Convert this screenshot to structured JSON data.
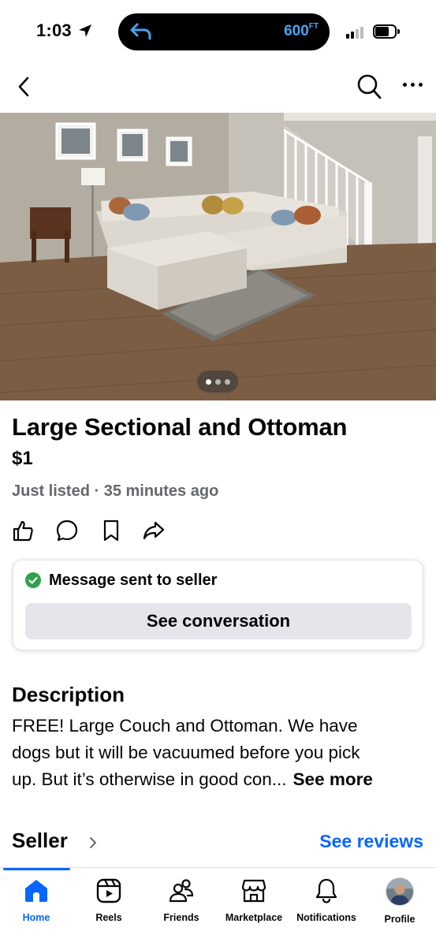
{
  "status_bar": {
    "time": "1:03",
    "altitude_value": "600",
    "altitude_unit": "FT"
  },
  "listing": {
    "title": "Large Sectional and Ottoman",
    "price": "$1",
    "meta": "Just listed · 35 minutes ago",
    "photo_pager": {
      "total": 3,
      "current": 1
    }
  },
  "message_card": {
    "status_text": "Message sent to seller",
    "button_label": "See conversation",
    "status_color": "#31a24c"
  },
  "description": {
    "heading": "Description",
    "lines": [
      "FREE! Large Couch and Ottoman. We have",
      "dogs but it will be vacuumed before you pick",
      "up. But it’s otherwise in good con..."
    ],
    "see_more": "See more"
  },
  "seller": {
    "label": "Seller",
    "see_reviews": "See reviews"
  },
  "tabs": [
    {
      "label": "Home",
      "icon": "home-icon",
      "active": true
    },
    {
      "label": "Reels",
      "icon": "reels-icon",
      "active": false
    },
    {
      "label": "Friends",
      "icon": "friends-icon",
      "active": false
    },
    {
      "label": "Marketplace",
      "icon": "marketplace-icon",
      "active": false
    },
    {
      "label": "Notifications",
      "icon": "bell-icon",
      "active": false
    },
    {
      "label": "Profile",
      "icon": "avatar",
      "active": false
    }
  ],
  "colors": {
    "accent": "#0866ff",
    "secondary_text": "#65676b",
    "button_bg": "#e4e6eb"
  }
}
